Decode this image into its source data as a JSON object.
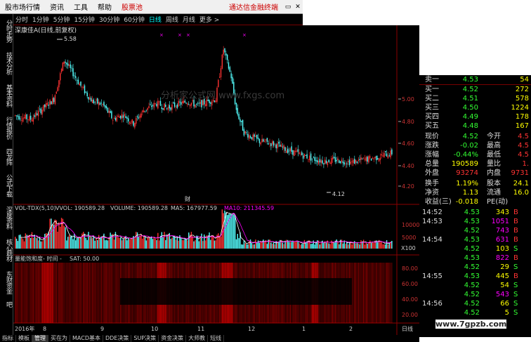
{
  "menubar": {
    "items": [
      "股市场行情",
      "资讯",
      "工具",
      "帮助"
    ],
    "highlight": "股票池",
    "notice": "通达信金融终端",
    "controls": [
      "▭",
      "✕"
    ]
  },
  "leftbar": {
    "tabs": [
      "分时走势",
      "技术分析",
      "基本资料",
      "行情报价",
      "四龙阵",
      "公式下载",
      "深度资料",
      "核心题材",
      "东财资金",
      "吧"
    ]
  },
  "periods": [
    "分时",
    "1分钟",
    "5分钟",
    "15分钟",
    "30分钟",
    "60分钟",
    "日线",
    "周线",
    "月线",
    "更多 >"
  ],
  "active_period": "日线",
  "stock": {
    "title": "深康佳A(日线,前复权)"
  },
  "price_ticks": [
    "5.00",
    "4.80",
    "4.60",
    "4.40",
    "4.20"
  ],
  "annotations": {
    "high": "5.58",
    "low": "4.12",
    "watermark": "分析家公式网 www.fxgs.com",
    "caifu": "财"
  },
  "volume_header": {
    "indicator": "VOL-TDX(5,10)",
    "vvol": "VVOL: 190589.28",
    "volume": "VOLUME: 190589.28",
    "ma5": "MA5: 167977.59",
    "ma10": "MA10: 211345.59"
  },
  "volume_ticks": [
    "10000",
    "5000",
    "X100"
  ],
  "sat_header": {
    "name": "量能饱和度- 时间 -",
    "sat": "SAT: 50.00"
  },
  "sat_ticks": [
    "80.00",
    "60.00",
    "40.00",
    "20.00"
  ],
  "date_axis": {
    "year": "2016年",
    "months": [
      "8",
      "9",
      "10",
      "11",
      "12",
      "1",
      "2"
    ],
    "right_label": "日线"
  },
  "orderbook": {
    "sell": [
      {
        "label": "卖一",
        "price": "4.53",
        "vol": "54"
      }
    ],
    "buy": [
      {
        "label": "买一",
        "price": "4.52",
        "vol": "272"
      },
      {
        "label": "买二",
        "price": "4.51",
        "vol": "578"
      },
      {
        "label": "买三",
        "price": "4.50",
        "vol": "1224"
      },
      {
        "label": "买四",
        "price": "4.49",
        "vol": "178"
      },
      {
        "label": "买五",
        "price": "4.48",
        "vol": "167"
      }
    ]
  },
  "quote": [
    {
      "l1": "现价",
      "v1": "4.52",
      "l2": "今开",
      "v2": "4.5"
    },
    {
      "l1": "涨跌",
      "v1": "-0.02",
      "l2": "最高",
      "v2": "4.5"
    },
    {
      "l1": "涨幅",
      "v1": "-0.44%",
      "l2": "最低",
      "v2": "4.5"
    },
    {
      "l1": "总量",
      "v1": "190589",
      "l2": "量比",
      "v2": "1."
    },
    {
      "l1": "外盘",
      "v1": "93274",
      "l2": "内盘",
      "v2": "9731"
    }
  ],
  "stats": [
    {
      "l1": "换手",
      "v1": "1.19%",
      "l2": "股本",
      "v2": "24.1"
    },
    {
      "l1": "净资",
      "v1": "1.13",
      "l2": "流通",
      "v2": "16.0"
    },
    {
      "l1": "收益(三)",
      "v1": "-0.018",
      "l2": "PE(动)",
      "v2": ""
    }
  ],
  "ticks": [
    {
      "time": "14:52",
      "price": "4.53",
      "vol": "343",
      "bs": "B"
    },
    {
      "time": "14:53",
      "price": "4.53",
      "vol": "1051",
      "bs": "B"
    },
    {
      "time": "",
      "price": "4.52",
      "vol": "743",
      "bs": "B"
    },
    {
      "time": "14:54",
      "price": "4.53",
      "vol": "631",
      "bs": "B"
    },
    {
      "time": "",
      "price": "4.52",
      "vol": "103",
      "bs": "S"
    },
    {
      "time": "",
      "price": "4.53",
      "vol": "822",
      "bs": "B"
    },
    {
      "time": "",
      "price": "4.52",
      "vol": "29",
      "bs": "S"
    },
    {
      "time": "14:55",
      "price": "4.53",
      "vol": "445",
      "bs": "B"
    },
    {
      "time": "",
      "price": "4.52",
      "vol": "54",
      "bs": "S"
    },
    {
      "time": "",
      "price": "4.52",
      "vol": "543",
      "bs": "S"
    },
    {
      "time": "14:56",
      "price": "4.52",
      "vol": "66",
      "bs": "S"
    },
    {
      "time": "",
      "price": "4.52",
      "vol": "5",
      "bs": "S"
    }
  ],
  "bottom_tabs": [
    "指标",
    "模板",
    "管理",
    "买在为",
    "MACD基本",
    "DDE决策",
    "SUP决策",
    "资金决策",
    "大师教",
    "短线"
  ],
  "site_watermark": "www.7gpzb.com",
  "colors": {
    "up": "#ff3232",
    "down": "#54ffff",
    "ma5": "#ffffff",
    "ma10": "#ff00ff",
    "label": "#cccccc",
    "blue": "#5a9bd5"
  }
}
